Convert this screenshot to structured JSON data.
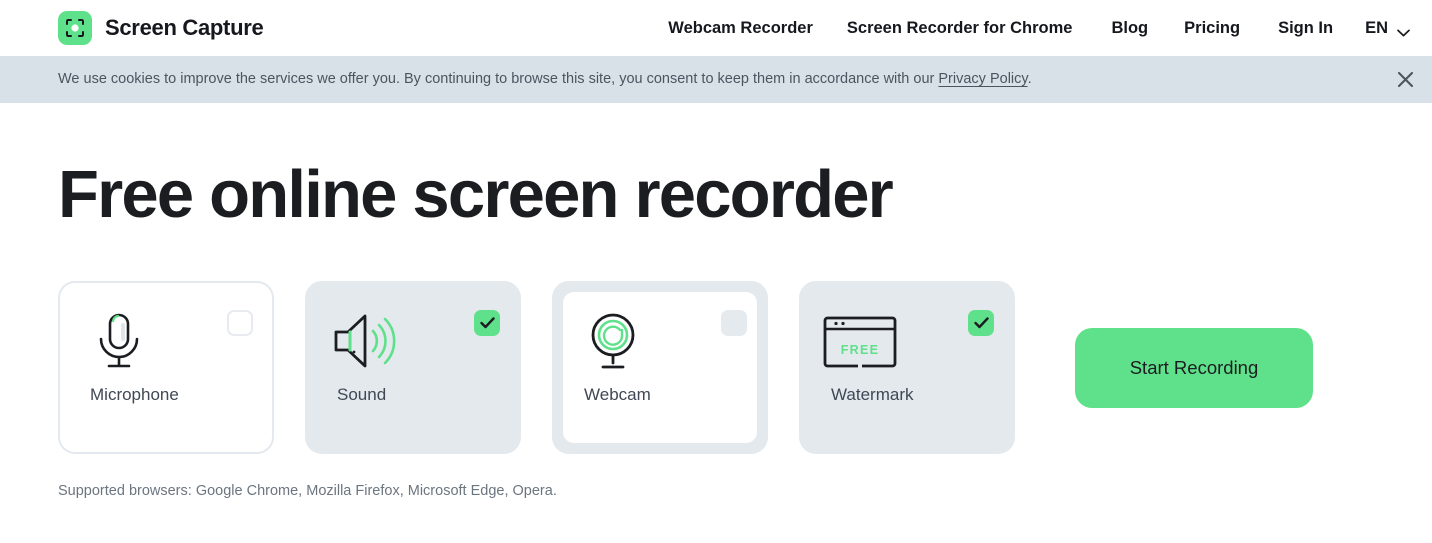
{
  "header": {
    "brand_name": "Screen Capture",
    "logo_icon": "screen-capture-logo-icon",
    "nav": [
      {
        "label": "Webcam Recorder",
        "name": "nav-webcam-recorder"
      },
      {
        "label": "Screen Recorder for Chrome",
        "name": "nav-screen-recorder-chrome"
      },
      {
        "label": "Blog",
        "name": "nav-blog"
      },
      {
        "label": "Pricing",
        "name": "nav-pricing"
      },
      {
        "label": "Sign In",
        "name": "nav-sign-in"
      }
    ],
    "language": {
      "label": "EN",
      "icon": "chevron-down-icon"
    }
  },
  "cookie_banner": {
    "text_before": "We use cookies to improve the services we offer you. By continuing to browse this site, you consent to keep them in accordance with our ",
    "link_label": "Privacy Policy",
    "text_after": ".",
    "close_icon": "close-icon",
    "background": "#d9e1e8"
  },
  "hero": {
    "title": "Free online screen recorder"
  },
  "options": [
    {
      "label": "Microphone",
      "icon": "microphone-icon",
      "checked": false,
      "state": "unselected"
    },
    {
      "label": "Sound",
      "icon": "speaker-icon",
      "checked": true,
      "state": "selected"
    },
    {
      "label": "Webcam",
      "icon": "webcam-icon",
      "checked": false,
      "state": "outline-frame"
    },
    {
      "label": "Watermark",
      "icon": "watermark-window-icon",
      "badge_text": "FREE",
      "checked": true,
      "state": "selected"
    }
  ],
  "cta": {
    "label": "Start Recording",
    "color": "#5fe08a"
  },
  "footnote": {
    "text": "Supported browsers: Google Chrome, Mozilla Firefox, Microsoft Edge, Opera."
  },
  "colors": {
    "accent_green": "#5fe08a",
    "card_selected_bg": "#e3e9ec",
    "cookie_bg": "#d9e1e8",
    "text_dark": "#1b1d21",
    "text_muted": "#6b7580"
  }
}
